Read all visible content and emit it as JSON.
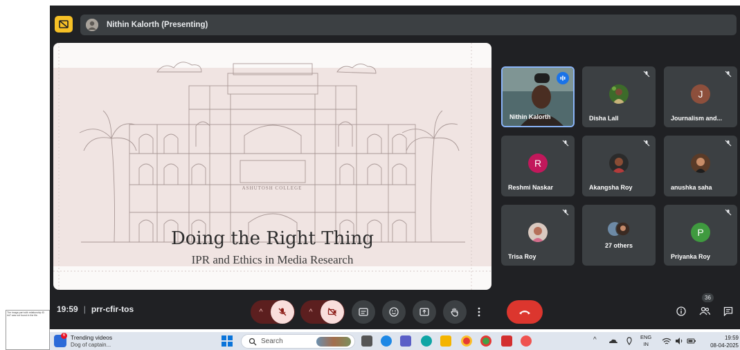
{
  "broken_image": {
    "alt": "The image part with relationship ID rId7 was not found in the file."
  },
  "presenter": {
    "label": "Nithin Kalorth (Presenting)"
  },
  "slide": {
    "college_sign": "ASHUTOSH COLLEGE",
    "title": "Doing the Right Thing",
    "subtitle": "IPR and Ethics in Media Research"
  },
  "participants": [
    {
      "name": "Nithin Kalorth",
      "type": "video",
      "speaking": true
    },
    {
      "name": "Disha Lall",
      "type": "photo",
      "muted": true
    },
    {
      "name": "Journalism and...",
      "type": "letter",
      "letter": "J",
      "color": "#8d4f3c",
      "muted": true
    },
    {
      "name": "Reshmi Naskar",
      "type": "letter",
      "letter": "R",
      "color": "#c2185b",
      "muted": true
    },
    {
      "name": "Akangsha Roy",
      "type": "photo",
      "muted": true
    },
    {
      "name": "anushka saha",
      "type": "photo",
      "muted": true
    },
    {
      "name": "Trisa Roy",
      "type": "photo",
      "muted": true
    },
    {
      "name": "27 others",
      "type": "group"
    },
    {
      "name": "Priyanka Roy",
      "type": "letter",
      "letter": "P",
      "color": "#3f9a3f",
      "muted": true
    }
  ],
  "meeting": {
    "time": "19:59",
    "code": "prr-cfir-tos",
    "people_count": "36"
  },
  "controls": {
    "mic": "mic-off-icon",
    "camera": "camera-off-icon",
    "captions": "captions-icon",
    "emoji": "emoji-icon",
    "present": "present-icon",
    "hand": "raise-hand-icon",
    "more": "more-vert-icon",
    "hangup": "call-end-icon"
  },
  "taskbar": {
    "widget_badge": "6",
    "widget_title": "Trending videos",
    "widget_subtitle": "Dog of captain...",
    "search_placeholder": "Search",
    "lang_top": "ENG",
    "lang_bottom": "IN",
    "time": "19:59",
    "date": "08-04-2025"
  },
  "colors": {
    "meet_bg": "#202124",
    "tile_bg": "#3c4043",
    "hangup": "#dc362e",
    "accent_blue": "#8ab4f8",
    "cast_yellow": "#f6c026"
  }
}
